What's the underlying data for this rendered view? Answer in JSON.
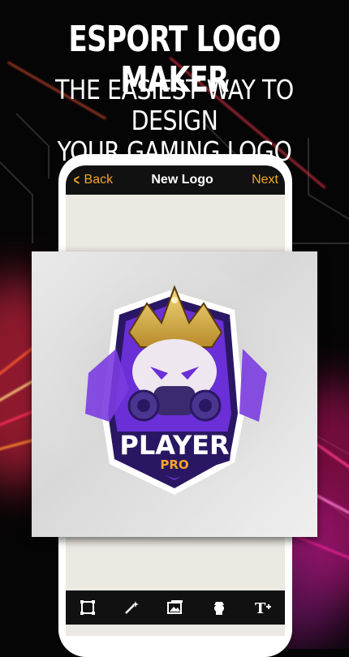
{
  "header": {
    "headline": "Esport logo maker",
    "subline_1": "THE EASIEST WAY TO DESIGN",
    "subline_2": "YOUR GAMING LOGO"
  },
  "appbar": {
    "back_label": "Back",
    "title": "New Logo",
    "next_label": "Next"
  },
  "logo": {
    "text_main": "PLAYER",
    "text_sub": "PRO"
  },
  "toolbar": {
    "items": [
      "crop-icon",
      "magic-wand-icon",
      "image-icon",
      "mascot-icon",
      "text-add-icon"
    ]
  },
  "colors": {
    "accent": "#f5a623",
    "logo_purple": "#6a2fd6",
    "logo_dark": "#2a1763",
    "crown_gold": "#d9b34a"
  }
}
